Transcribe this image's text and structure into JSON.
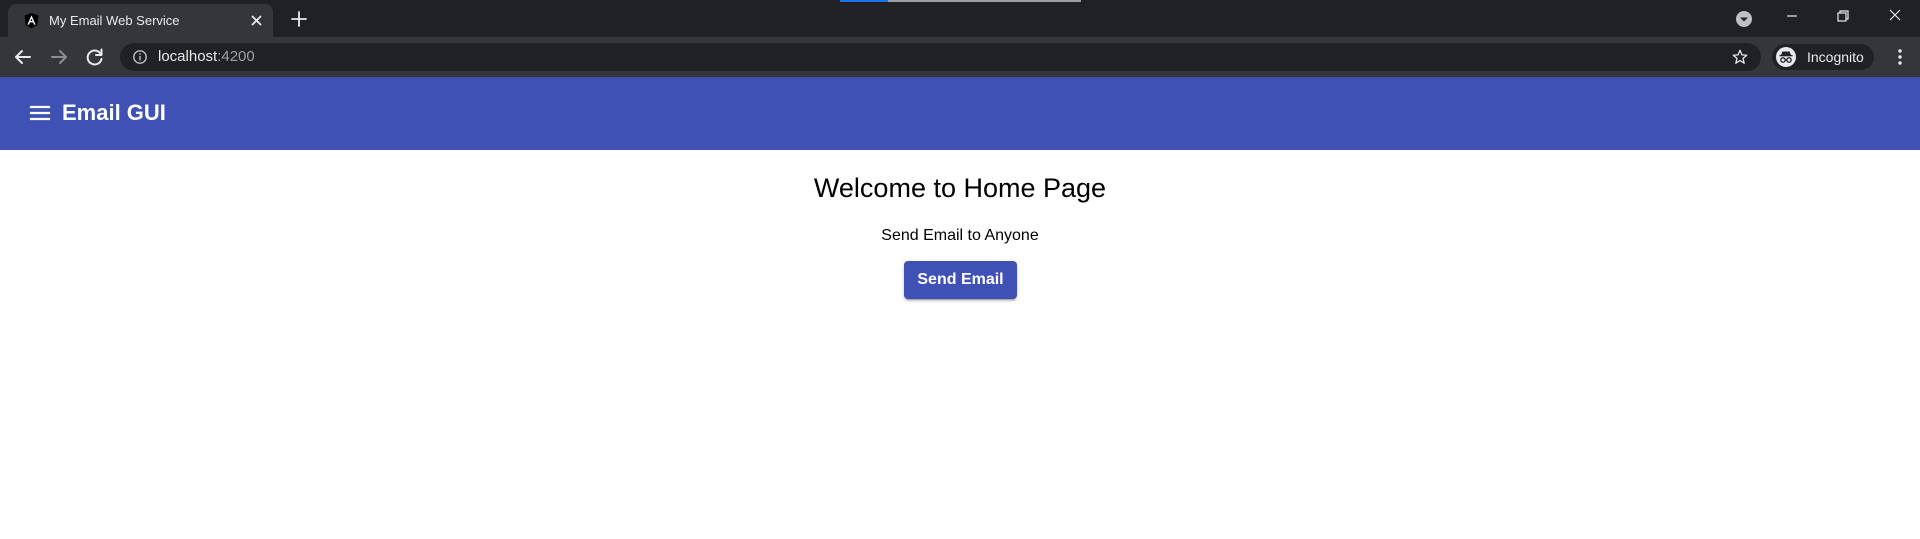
{
  "browser": {
    "tab_title": "My Email Web Service",
    "url_host": "localhost",
    "url_port": ":4200",
    "profile_label": "Incognito",
    "colors": {
      "tabstrip": "#202124",
      "active_tab": "#35363a",
      "omnibox": "#202124",
      "text": "#e8eaed",
      "muted_text": "#9aa0a6"
    },
    "icons": [
      "angular-logo-icon",
      "close-icon",
      "plus-icon",
      "tab-search-icon",
      "minimize-icon",
      "restore-icon",
      "window-close-icon",
      "back-arrow-icon",
      "forward-arrow-icon",
      "reload-icon",
      "info-icon",
      "star-icon",
      "incognito-icon",
      "more-vert-icon"
    ]
  },
  "app": {
    "title": "Email GUI",
    "accent_color": "#3f51b5",
    "icons": [
      "hamburger-menu-icon"
    ]
  },
  "main": {
    "heading": "Welcome to Home Page",
    "subtitle": "Send Email to Anyone",
    "send_button_label": "Send Email"
  }
}
